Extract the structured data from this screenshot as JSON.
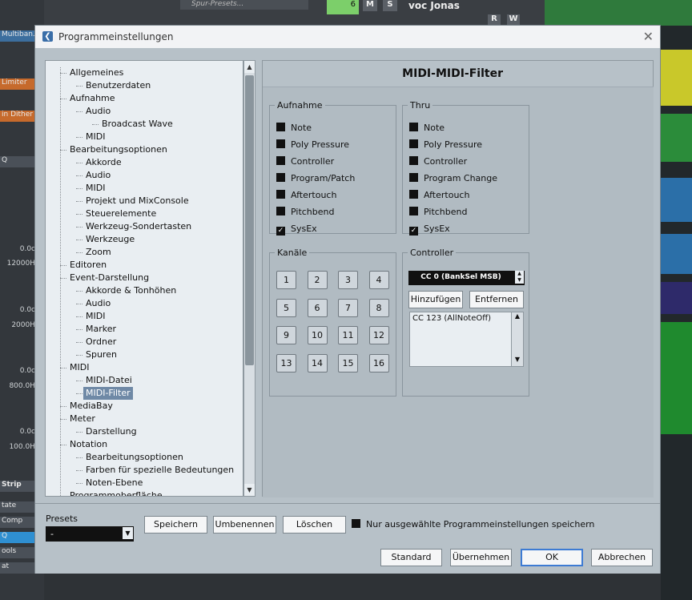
{
  "background": {
    "left_labels": [
      "Multiban...o",
      "Limiter",
      "in Dither",
      "Q",
      "Strip",
      "tate",
      "Comp",
      "Q",
      "ools",
      "at"
    ],
    "left_values": [
      "0.0c",
      "12000H",
      "0.0c",
      "2000H",
      "0.0c",
      "800.0H",
      "0.0c",
      "100.0H"
    ],
    "track_presets": "Spur-Presets...",
    "track_number": "6",
    "mute": "M",
    "solo": "S",
    "track_name": "voc Jonas",
    "read": "R",
    "write": "W"
  },
  "dialog": {
    "title": "Programmeinstellungen",
    "close": "✕",
    "panel_title": "MIDI-MIDI-Filter",
    "tree": [
      {
        "label": "Allgemeines",
        "level": 0
      },
      {
        "label": "Benutzerdaten",
        "level": 1
      },
      {
        "label": "Aufnahme",
        "level": 0
      },
      {
        "label": "Audio",
        "level": 1
      },
      {
        "label": "Broadcast Wave",
        "level": 2
      },
      {
        "label": "MIDI",
        "level": 1
      },
      {
        "label": "Bearbeitungsoptionen",
        "level": 0
      },
      {
        "label": "Akkorde",
        "level": 1
      },
      {
        "label": "Audio",
        "level": 1
      },
      {
        "label": "MIDI",
        "level": 1
      },
      {
        "label": "Projekt und MixConsole",
        "level": 1
      },
      {
        "label": "Steuerelemente",
        "level": 1
      },
      {
        "label": "Werkzeug-Sondertasten",
        "level": 1
      },
      {
        "label": "Werkzeuge",
        "level": 1
      },
      {
        "label": "Zoom",
        "level": 1
      },
      {
        "label": "Editoren",
        "level": 0
      },
      {
        "label": "Event-Darstellung",
        "level": 0
      },
      {
        "label": "Akkorde & Tonhöhen",
        "level": 1
      },
      {
        "label": "Audio",
        "level": 1
      },
      {
        "label": "MIDI",
        "level": 1
      },
      {
        "label": "Marker",
        "level": 1
      },
      {
        "label": "Ordner",
        "level": 1
      },
      {
        "label": "Spuren",
        "level": 1
      },
      {
        "label": "MIDI",
        "level": 0
      },
      {
        "label": "MIDI-Datei",
        "level": 1
      },
      {
        "label": "MIDI-Filter",
        "level": 1,
        "selected": true
      },
      {
        "label": "MediaBay",
        "level": 0
      },
      {
        "label": "Meter",
        "level": 0
      },
      {
        "label": "Darstellung",
        "level": 1
      },
      {
        "label": "Notation",
        "level": 0
      },
      {
        "label": "Bearbeitungsoptionen",
        "level": 1
      },
      {
        "label": "Farben für spezielle Bedeutungen",
        "level": 1
      },
      {
        "label": "Noten-Ebene",
        "level": 1
      },
      {
        "label": "Programmoberfläche",
        "level": 0
      }
    ],
    "aufnahme": {
      "legend": "Aufnahme",
      "items": [
        {
          "label": "Note",
          "checked": false
        },
        {
          "label": "Poly Pressure",
          "checked": false
        },
        {
          "label": "Controller",
          "checked": false
        },
        {
          "label": "Program/Patch",
          "checked": false
        },
        {
          "label": "Aftertouch",
          "checked": false
        },
        {
          "label": "Pitchbend",
          "checked": false
        },
        {
          "label": "SysEx",
          "checked": true
        }
      ]
    },
    "thru": {
      "legend": "Thru",
      "items": [
        {
          "label": "Note",
          "checked": false
        },
        {
          "label": "Poly Pressure",
          "checked": false
        },
        {
          "label": "Controller",
          "checked": false
        },
        {
          "label": "Program Change",
          "checked": false
        },
        {
          "label": "Aftertouch",
          "checked": false
        },
        {
          "label": "Pitchbend",
          "checked": false
        },
        {
          "label": "SysEx",
          "checked": true
        }
      ]
    },
    "kanaele": {
      "legend": "Kanäle",
      "channels": [
        "1",
        "2",
        "3",
        "4",
        "5",
        "6",
        "7",
        "8",
        "9",
        "10",
        "11",
        "12",
        "13",
        "14",
        "15",
        "16"
      ]
    },
    "controller": {
      "legend": "Controller",
      "selected": "CC 0  (BankSel MSB)",
      "add": "Hinzufügen",
      "remove": "Entfernen",
      "list": [
        "CC 123  (AllNoteOff)"
      ]
    },
    "presets": {
      "label": "Presets",
      "value": "-",
      "save": "Speichern",
      "rename": "Umbenennen",
      "delete": "Löschen",
      "only_selected": "Nur ausgewählte Programmeinstellungen speichern"
    },
    "buttons": {
      "standard": "Standard",
      "apply": "Übernehmen",
      "ok": "OK",
      "cancel": "Abbrechen"
    }
  }
}
